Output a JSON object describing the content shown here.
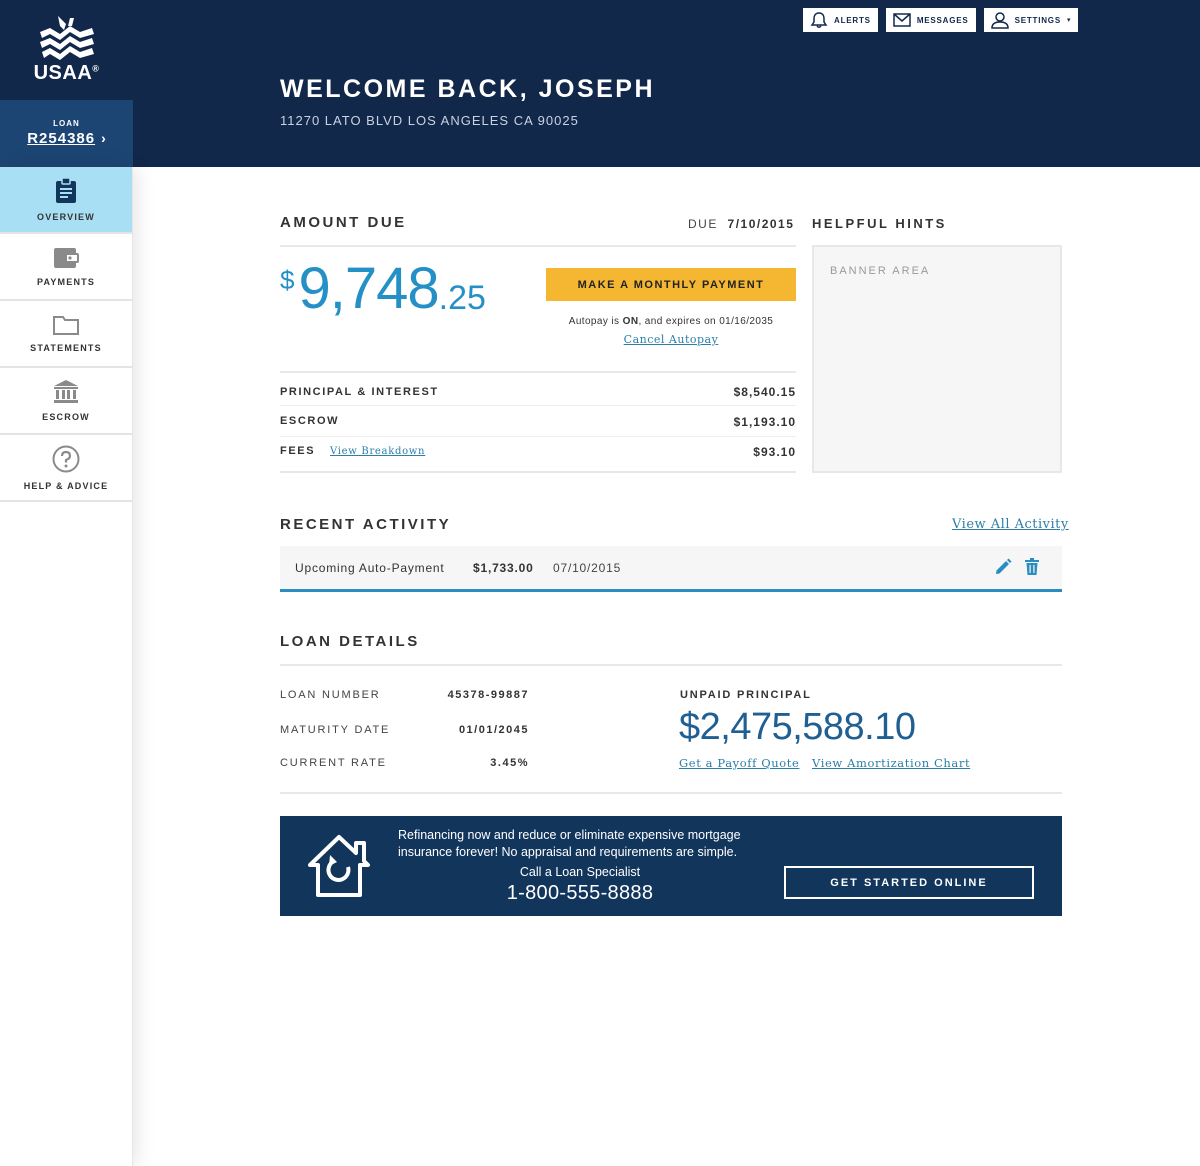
{
  "brand": {
    "name": "USAA",
    "reg": "®"
  },
  "loan": {
    "label": "LOAN",
    "number": "R254386"
  },
  "top_buttons": {
    "alerts": "ALERTS",
    "messages": "MESSAGES",
    "settings": "SETTINGS"
  },
  "header": {
    "welcome": "WELCOME BACK, JOSEPH",
    "address": "11270 LATO BLVD LOS ANGELES CA 90025"
  },
  "nav": {
    "items": [
      {
        "label": "OVERVIEW",
        "icon": "clipboard-icon",
        "active": true
      },
      {
        "label": "PAYMENTS",
        "icon": "wallet-icon"
      },
      {
        "label": "STATEMENTS",
        "icon": "folder-icon"
      },
      {
        "label": "ESCROW",
        "icon": "bank-icon"
      },
      {
        "label": "HELP & ADVICE",
        "icon": "question-icon"
      }
    ]
  },
  "amount_due": {
    "title": "AMOUNT DUE",
    "due_label": "DUE",
    "due_date": "7/10/2015",
    "currency": "$",
    "amount_whole": "9,748",
    "amount_cents": ".25",
    "pay_button": "MAKE A MONTHLY PAYMENT",
    "autopay_prefix": "Autopay is",
    "autopay_status": "ON",
    "autopay_suffix": ", and expires on 01/16/2035",
    "cancel_link": "Cancel Autopay",
    "breakdown": [
      {
        "label": "PRINCIPAL & INTEREST",
        "value": "$8,540.15"
      },
      {
        "label": "ESCROW",
        "value": "$1,193.10"
      },
      {
        "label": "FEES",
        "value": "$93.10",
        "link": "View Breakdown"
      }
    ]
  },
  "hints": {
    "title": "HELPFUL HINTS",
    "banner": "BANNER AREA"
  },
  "activity": {
    "title": "RECENT ACTIVITY",
    "view_all": "View All Activity",
    "rows": [
      {
        "name": "Upcoming Auto-Payment",
        "amount": "$1,733.00",
        "date": "07/10/2015"
      }
    ]
  },
  "loan_details": {
    "title": "LOAN DETAILS",
    "rows": [
      {
        "label": "LOAN NUMBER",
        "value": "45378-99887"
      },
      {
        "label": "MATURITY DATE",
        "value": "01/01/2045"
      },
      {
        "label": "CURRENT RATE",
        "value": "3.45%"
      }
    ],
    "unpaid_label": "UNPAID PRINCIPAL",
    "unpaid_value": "$2,475,588.10",
    "payoff_link": "Get a Payoff Quote",
    "amort_link": "View Amortization Chart"
  },
  "promo": {
    "text": "Refinancing now and reduce or eliminate expensive mortgage insurance forever! No appraisal and requirements are simple.",
    "call": "Call a Loan Specialist",
    "phone": "1-800-555-8888",
    "button": "GET STARTED ONLINE",
    "icon": "house-refresh-icon"
  },
  "colors": {
    "navy": "#12284a",
    "accent_blue": "#2590c6",
    "button_yellow": "#f5b731",
    "active_nav": "#a9dff5"
  }
}
